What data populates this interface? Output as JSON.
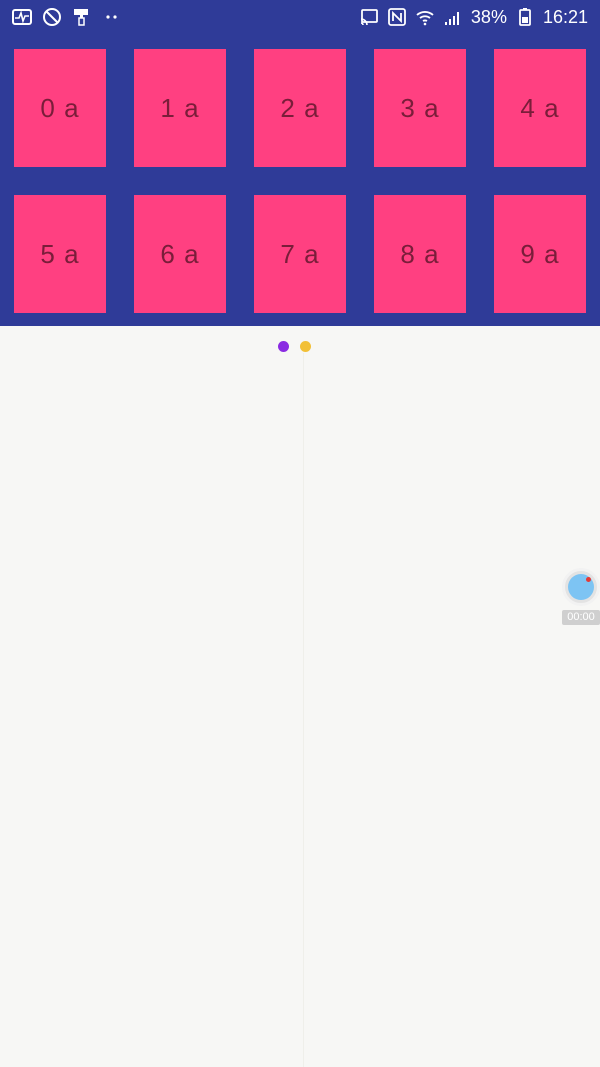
{
  "status_bar": {
    "left_icons": [
      "activity-icon",
      "blocked-icon",
      "paint-roller-icon",
      "more-dots-icon"
    ],
    "right_icons": [
      "cast-icon",
      "nfc-icon",
      "wifi-icon",
      "signal-icon"
    ],
    "battery_percent": "38%",
    "time": "16:21"
  },
  "grid": {
    "tiles": [
      {
        "label": "0 a"
      },
      {
        "label": "1 a"
      },
      {
        "label": "2 a"
      },
      {
        "label": "3 a"
      },
      {
        "label": "4 a"
      },
      {
        "label": "5 a"
      },
      {
        "label": "6 a"
      },
      {
        "label": "7 a"
      },
      {
        "label": "8 a"
      },
      {
        "label": "9 a"
      }
    ]
  },
  "page_indicator": {
    "dots": [
      {
        "color": "#8a2be2",
        "active": true
      },
      {
        "color": "#f2c037",
        "active": false
      }
    ]
  },
  "floating_recorder": {
    "timer": "00:00"
  },
  "colors": {
    "header_bg": "#2f3b98",
    "tile_bg": "#ff4081",
    "tile_text": "#7a1d3a",
    "page_bg": "#f7f7f5"
  }
}
